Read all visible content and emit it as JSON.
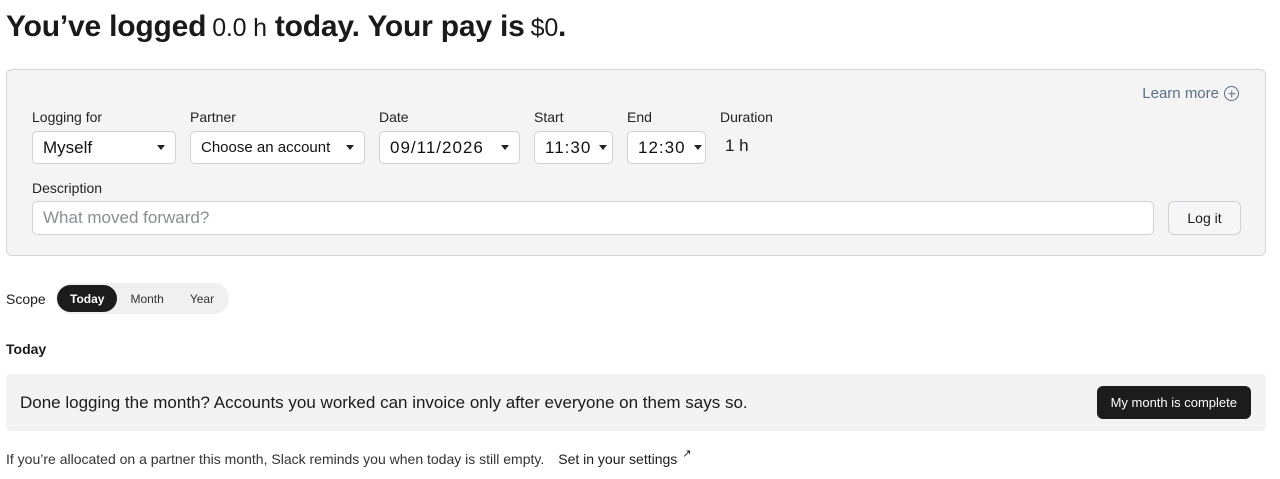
{
  "summary": {
    "prefix": "You’ve logged",
    "hours": "0.0 h",
    "middle": "today. Your pay is",
    "pay": "$0",
    "suffix": "."
  },
  "form": {
    "learn_more": "Learn more",
    "logging_for": {
      "label": "Logging for",
      "value": "Myself"
    },
    "partner": {
      "label": "Partner",
      "value": "Choose an account"
    },
    "date": {
      "label": "Date",
      "value": "09/11/2026"
    },
    "start": {
      "label": "Start",
      "value": "11:30"
    },
    "end": {
      "label": "End",
      "value": "12:30"
    },
    "duration": {
      "label": "Duration",
      "value": "1 h"
    },
    "description": {
      "label": "Description",
      "placeholder": "What moved forward?",
      "value": ""
    },
    "submit_label": "Log it"
  },
  "scope": {
    "label": "Scope",
    "options": [
      "Today",
      "Month",
      "Year"
    ],
    "selected": "Today"
  },
  "section_title": "Today",
  "banner": {
    "text": "Done logging the month? Accounts you worked can invoice only after everyone on them says so.",
    "button_label": "My month is complete"
  },
  "footer": {
    "text": "If you’re allocated on a partner this month, Slack reminds you when today is still empty.",
    "link_label": "Set in your settings",
    "link_icon": "↗"
  },
  "colors": {
    "accent_dark": "#1c1c1c",
    "link_muted": "#5b6d86",
    "card_bg": "#f4f4f5"
  }
}
